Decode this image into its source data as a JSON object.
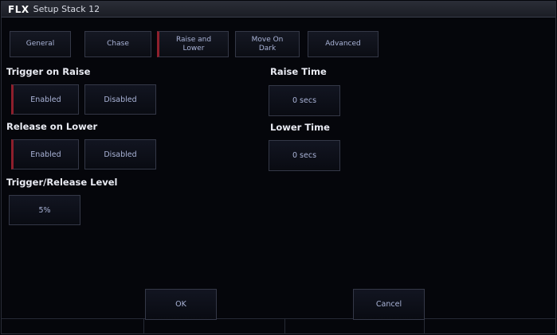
{
  "window": {
    "brand": "FLX",
    "title": "Setup Stack 12"
  },
  "tabs": [
    {
      "label": "General",
      "active": false
    },
    {
      "label": "Chase",
      "active": false
    },
    {
      "label": "Raise and\nLower",
      "active": true
    },
    {
      "label": "Move On\nDark",
      "active": false
    },
    {
      "label": "Advanced",
      "active": false
    }
  ],
  "trigger_on_raise": {
    "label": "Trigger on Raise",
    "enabled_label": "Enabled",
    "disabled_label": "Disabled",
    "selected": "Enabled"
  },
  "release_on_lower": {
    "label": "Release on Lower",
    "enabled_label": "Enabled",
    "disabled_label": "Disabled",
    "selected": "Enabled"
  },
  "raise_time": {
    "label": "Raise Time",
    "value": "0 secs"
  },
  "lower_time": {
    "label": "Lower Time",
    "value": "0 secs"
  },
  "trigger_release_level": {
    "label": "Trigger/Release Level",
    "value": "5%"
  },
  "footer": {
    "ok_label": "OK",
    "cancel_label": "Cancel"
  },
  "colors": {
    "background": "#05060b",
    "selected_accent": "#8e1f2c",
    "button_text": "#aab4d8",
    "label_text": "#e9ebf3"
  }
}
